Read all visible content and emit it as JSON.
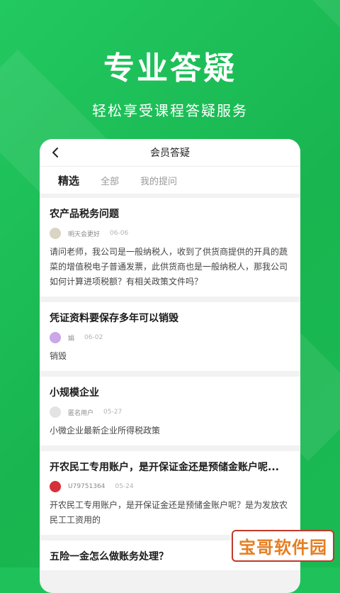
{
  "hero": {
    "title": "专业答疑",
    "subtitle": "轻松享受课程答疑服务"
  },
  "nav": {
    "title": "会员答疑"
  },
  "tabs": [
    {
      "label": "精选",
      "active": true
    },
    {
      "label": "全部",
      "active": false
    },
    {
      "label": "我的提问",
      "active": false
    }
  ],
  "questions": [
    {
      "title": "农产品税务问题",
      "user": "明天会更好",
      "date": "06-06",
      "body": "请问老师，我公司是一般纳税人，收到了供货商提供的开具的蔬菜的增值税电子普通发票，此供货商也是一般纳税人，那我公司如何计算进项税额？有相关政策文件吗？",
      "avatar_color": "#d9d4c4"
    },
    {
      "title": "凭证资料要保存多年可以销毁",
      "user": "娟",
      "date": "06-02",
      "body": "销毁",
      "avatar_color": "#c9a7e8"
    },
    {
      "title": "小规模企业",
      "user": "匿名用户",
      "date": "05-27",
      "body": "小微企业最新企业所得税政策",
      "avatar_color": "#e3e3e3"
    },
    {
      "title": "开农民工专用账户，是开保证金还是预储金账户呢...",
      "user": "U79751364",
      "date": "05-24",
      "body": "开农民工专用账户，是开保证金还是预储金账户呢？是为发放农民工工资用的",
      "avatar_color": "#d6303a"
    },
    {
      "title": "五险一金怎么做账务处理？",
      "user": "",
      "date": "",
      "body": "",
      "avatar_color": "#e3e3e3"
    }
  ],
  "watermark": "宝哥软件园",
  "colors": {
    "brand_green": "#1fc25a",
    "watermark_red": "#c0392b",
    "watermark_orange": "#e67e22"
  },
  "icons": {
    "back": "chevron-left-icon"
  }
}
